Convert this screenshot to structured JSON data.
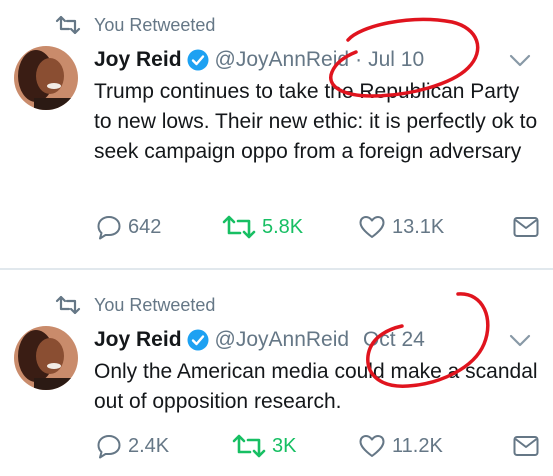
{
  "tweets": [
    {
      "retweet_label": "You Retweeted",
      "author_name": "Joy Reid",
      "handle": "@JoyAnnReid",
      "separator": "·",
      "date": "Jul 10",
      "text": "Trump continues to take the Republican Party to new lows. Their new ethic: it is perfectly ok to seek campaign oppo from a foreign adversary",
      "replies": "642",
      "retweets": "5.8K",
      "likes": "13.1K"
    },
    {
      "retweet_label": "You Retweeted",
      "author_name": "Joy Reid",
      "handle": "@JoyAnnReid",
      "date": "Oct 24",
      "text": "Only the American media could make a scandal out of opposition research.",
      "replies": "2.4K",
      "retweets": "3K",
      "likes": "11.2K"
    }
  ],
  "colors": {
    "retweet_green": "#17bf63",
    "verified_blue": "#1da1f2",
    "muted_gray": "#657786",
    "annotation_red": "#e0141e"
  },
  "icons": [
    "retweet-icon",
    "verified-badge-icon",
    "chevron-down-icon",
    "reply-icon",
    "like-icon",
    "direct-message-icon"
  ]
}
